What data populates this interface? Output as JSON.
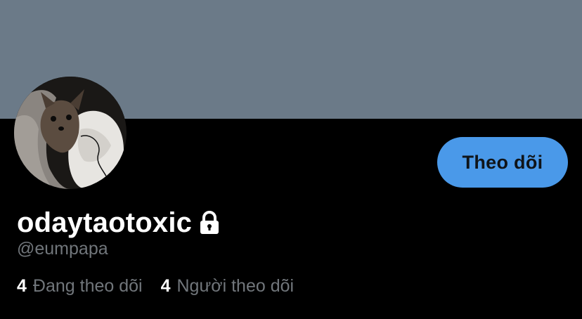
{
  "profile": {
    "display_name": "odaytaotoxic",
    "handle": "@eumpapa",
    "protected_icon": "lock-icon",
    "avatar_icon": "avatar-photo"
  },
  "actions": {
    "follow_label": "Theo dõi"
  },
  "stats": {
    "following_count": "4",
    "following_label": "Đang theo dõi",
    "followers_count": "4",
    "followers_label": "Người theo dõi"
  },
  "colors": {
    "banner": "#6b7a88",
    "background": "#000000",
    "accent": "#4a99e9",
    "secondary_text": "#71767b"
  }
}
